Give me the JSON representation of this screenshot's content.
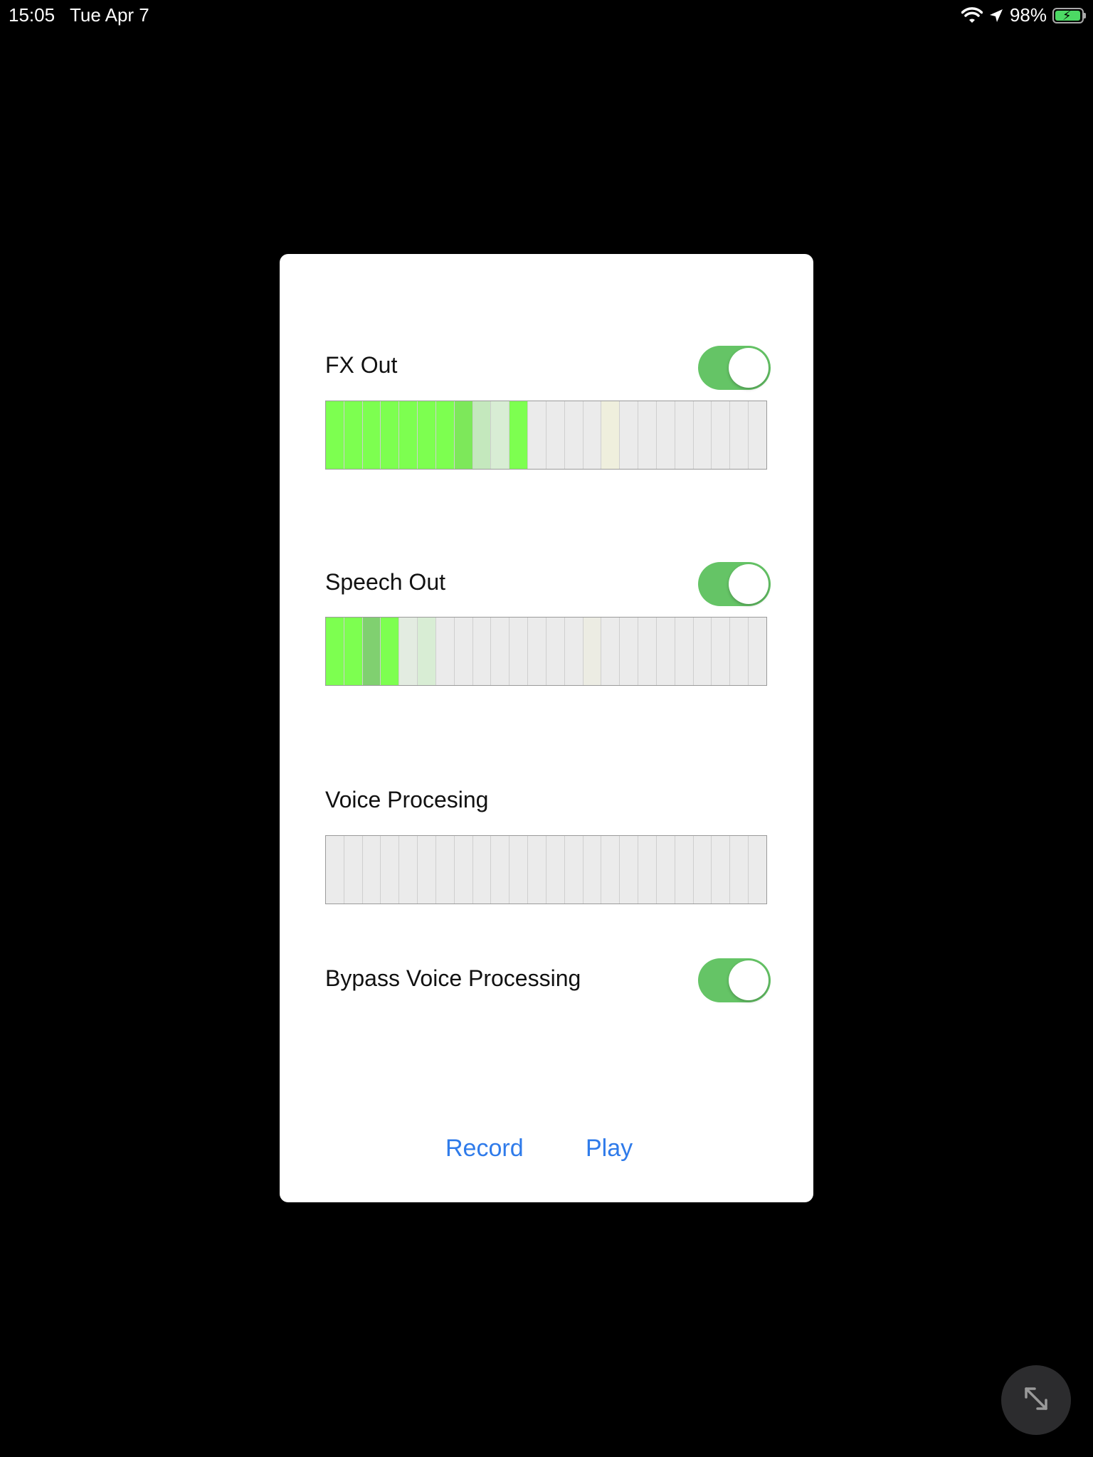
{
  "status_bar": {
    "time": "15:05",
    "date": "Tue Apr 7",
    "battery_percent": "98%",
    "battery_level": 0.98,
    "icons": [
      "wifi-icon",
      "location-arrow-icon",
      "battery-charging-icon"
    ]
  },
  "panel": {
    "fx_out": {
      "label": "FX Out",
      "toggle_on": true,
      "meter_segments": [
        "#7dff50",
        "#7dff50",
        "#7dff50",
        "#7dff50",
        "#7dff50",
        "#7dff50",
        "#7dff50",
        "#7de85a",
        "#c4e8bd",
        "#d8edd4",
        "#7dff50",
        "#ebebeb",
        "#ebebeb",
        "#ebebeb",
        "#ebebeb",
        "#efefdd",
        "#ebebeb",
        "#ebebeb",
        "#ebebeb",
        "#ebebeb",
        "#ebebeb",
        "#ebebeb",
        "#ebebeb",
        "#ebebeb"
      ]
    },
    "speech_out": {
      "label": "Speech Out",
      "toggle_on": true,
      "meter_segments": [
        "#7dff50",
        "#7dff50",
        "#80d070",
        "#7dff50",
        "#e3ece1",
        "#d8edd4",
        "#ebebeb",
        "#ebebeb",
        "#ebebeb",
        "#ebebeb",
        "#ebebeb",
        "#ebebeb",
        "#ebebeb",
        "#ebebeb",
        "#ecece3",
        "#ebebeb",
        "#ebebeb",
        "#ebebeb",
        "#ebebeb",
        "#ebebeb",
        "#ebebeb",
        "#ebebeb",
        "#ebebeb",
        "#ebebeb"
      ]
    },
    "voice_processing": {
      "label": "Voice Procesing",
      "meter_segments": [
        "#ebebeb",
        "#ebebeb",
        "#ebebeb",
        "#ebebeb",
        "#ebebeb",
        "#ebebeb",
        "#ebebeb",
        "#ebebeb",
        "#ebebeb",
        "#ebebeb",
        "#ebebeb",
        "#ebebeb",
        "#ebebeb",
        "#ebebeb",
        "#ebebeb",
        "#ebebeb",
        "#ebebeb",
        "#ebebeb",
        "#ebebeb",
        "#ebebeb",
        "#ebebeb",
        "#ebebeb",
        "#ebebeb",
        "#ebebeb"
      ]
    },
    "bypass": {
      "label": "Bypass Voice Processing",
      "toggle_on": true
    },
    "record_label": "Record",
    "play_label": "Play"
  },
  "colors": {
    "toggle_on": "#65c466",
    "link_blue": "#2f7bea",
    "meter_green": "#7dff50",
    "meter_off": "#ebebeb"
  },
  "floating_button_icon": "expand-arrows-icon"
}
